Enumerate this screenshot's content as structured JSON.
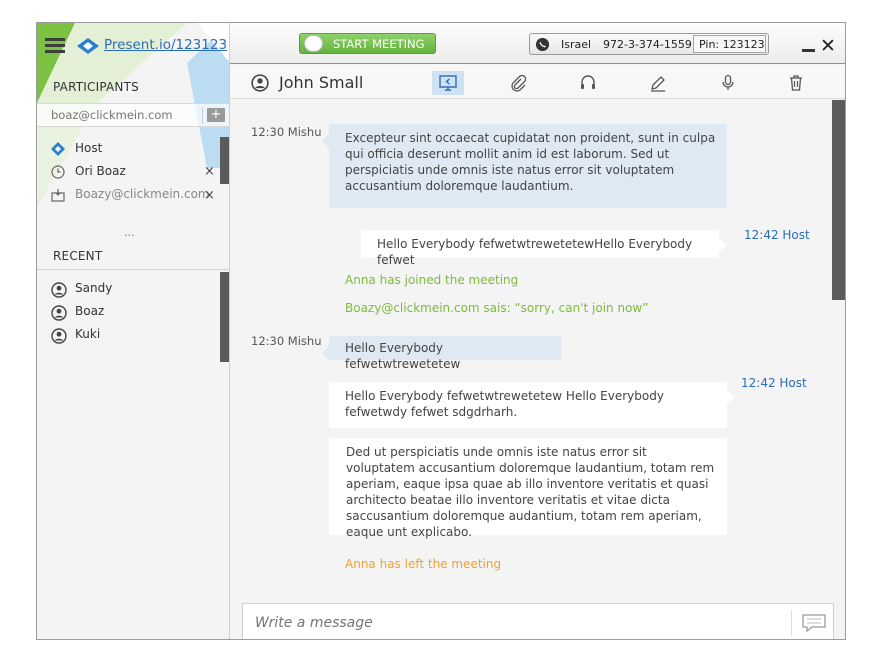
{
  "brand": {
    "link": "Present.io/123123"
  },
  "header": {
    "start_meeting": "START MEETING",
    "country": "Israel",
    "phone": "972-3-374-1559",
    "pin": "Pin: 123123"
  },
  "sidebar": {
    "participants_label": "PARTICIPANTS",
    "invite_placeholder": "boaz@clickmein.com",
    "participants": [
      {
        "label": "Host"
      },
      {
        "label": "Ori Boaz"
      },
      {
        "label": "Boazy@clickmein.com"
      }
    ],
    "more": "...",
    "recent_label": "RECENT",
    "recent": [
      {
        "label": "Sandy"
      },
      {
        "label": "Boaz"
      },
      {
        "label": "Kuki"
      }
    ]
  },
  "chat": {
    "title": "John Small",
    "messages": [
      {
        "time": "12:30 Mishu",
        "text": "Excepteur sint occaecat cupidatat non proident, sunt in culpa qui officia deserunt mollit anim id est laborum. Sed ut perspiciatis unde omnis iste natus error sit voluptatem accusantium doloremque laudantium."
      },
      {
        "time": "12:42 Host",
        "text": "Hello Everybody  fefwetwtrewetetewHello Everybody  fefwet"
      },
      {
        "text": "Anna has joined the meeting"
      },
      {
        "text": "Boazy@clickmein.com sais: “sorry, can't join now”"
      },
      {
        "time": "12:30 Mishu",
        "text": "Hello Everybody  fefwetwtrewetetew"
      },
      {
        "time": "12:42 Host",
        "text": "Hello Everybody  fefwetwtrewetetew Hello Everybody  fefwetwdy fefwet sdgdrharh."
      },
      {
        "text": "Ded ut perspiciatis unde omnis iste natus error sit voluptatem accusantium doloremque laudantium, totam rem aperiam, eaque ipsa quae ab illo inventore veritatis et quasi architecto beatae illo inventore veritatis et vitae dicta saccusantium doloremque audantium, totam rem aperiam, eaque unt explicabo."
      },
      {
        "text": "Anna has left the meeting"
      }
    ],
    "composer_placeholder": "Write a message"
  },
  "colors": {
    "accent_green": "#6db34a",
    "link_blue": "#2b6cb6",
    "bubble_blue": "#dfe9f3",
    "system_orange": "#f0a030"
  }
}
